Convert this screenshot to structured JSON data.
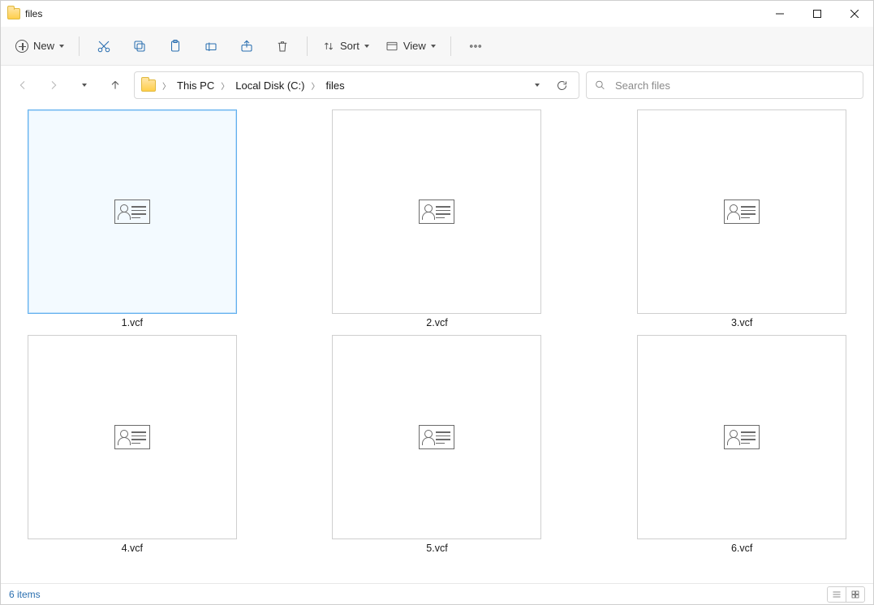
{
  "window": {
    "title": "files"
  },
  "toolbar": {
    "new_label": "New",
    "sort_label": "Sort",
    "view_label": "View"
  },
  "breadcrumbs": [
    {
      "label": "This PC"
    },
    {
      "label": "Local Disk (C:)"
    },
    {
      "label": "files"
    }
  ],
  "search": {
    "placeholder": "Search files"
  },
  "files": [
    {
      "name": "1.vcf",
      "selected": true
    },
    {
      "name": "2.vcf",
      "selected": false
    },
    {
      "name": "3.vcf",
      "selected": false
    },
    {
      "name": "4.vcf",
      "selected": false
    },
    {
      "name": "5.vcf",
      "selected": false
    },
    {
      "name": "6.vcf",
      "selected": false
    }
  ],
  "status": {
    "item_count_text": "6 items"
  }
}
